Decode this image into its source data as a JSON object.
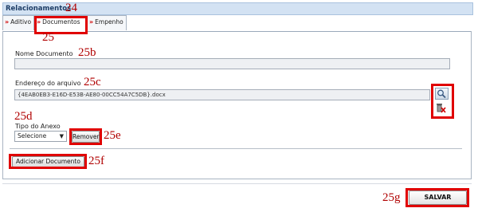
{
  "header": {
    "title": "Relacionamentos"
  },
  "tabs": [
    {
      "label": "Aditivo"
    },
    {
      "label": "Documentos"
    },
    {
      "label": "Empenho"
    }
  ],
  "form": {
    "nome_label": "Nome Documento",
    "nome_value": "",
    "endereco_label": "Endereço do arquivo",
    "endereco_value": "{4EAB0EB3-E16D-E53B-AE80-00CC54A7C5DB}.docx",
    "tipo_label": "Tipo do Anexo",
    "tipo_selected": "Selecione",
    "remover_label": "Remover",
    "adicionar_label": "Adicionar Documento"
  },
  "actions": {
    "salvar_label": "SALVAR"
  },
  "annotations": {
    "a24": "24",
    "a25": "25",
    "a25b": "25b",
    "a25c": "25c",
    "a25d": "25d",
    "a25e": "25e",
    "a25f": "25f",
    "a25g": "25g"
  },
  "icons": {
    "browse": "magnifier-icon",
    "delete": "trash-delete-icon",
    "tab_chevron": "double-chevron-down-icon"
  },
  "colors": {
    "annotation": "#e00000",
    "header_bg": "#d3e2f3",
    "header_text": "#1d3d66"
  }
}
